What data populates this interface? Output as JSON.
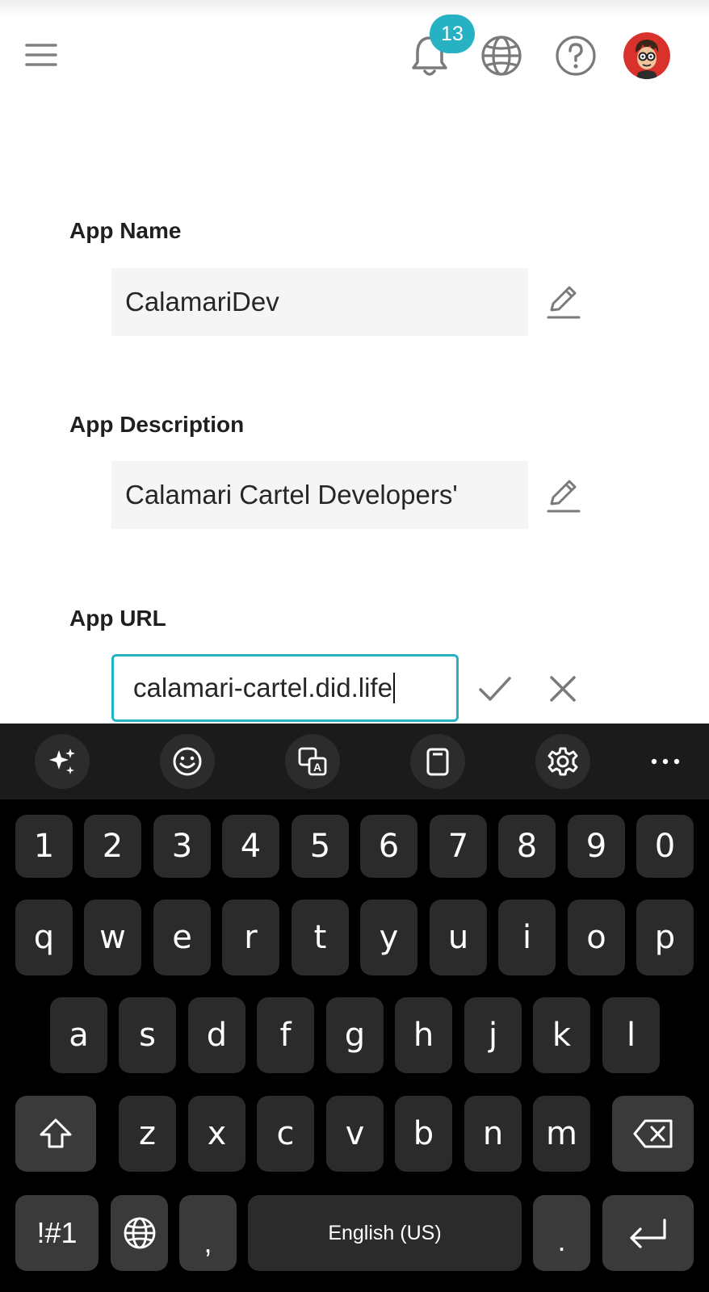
{
  "header": {
    "menu_icon": "hamburger-menu-icon",
    "notifications": {
      "icon": "bell-icon",
      "count": "13"
    },
    "language_icon": "globe-icon",
    "help_icon": "question-circle-icon",
    "avatar": "user-avatar"
  },
  "form": {
    "app_name": {
      "label": "App Name",
      "value": "CalamariDev"
    },
    "app_description": {
      "label": "App Description",
      "value": "Calamari Cartel Developers'"
    },
    "app_url": {
      "label": "App URL",
      "value": "calamari-cartel.did.life"
    }
  },
  "keyboard": {
    "toolbar": [
      "sparkle-ai-icon",
      "emoji-icon",
      "translate-icon",
      "clipboard-icon",
      "settings-gear-icon",
      "more-dots-icon"
    ],
    "row_numbers": [
      "1",
      "2",
      "3",
      "4",
      "5",
      "6",
      "7",
      "8",
      "9",
      "0"
    ],
    "row_top": [
      "q",
      "w",
      "e",
      "r",
      "t",
      "y",
      "u",
      "i",
      "o",
      "p"
    ],
    "row_middle": [
      "a",
      "s",
      "d",
      "f",
      "g",
      "h",
      "j",
      "k",
      "l"
    ],
    "row_bottom": [
      "z",
      "x",
      "c",
      "v",
      "b",
      "n",
      "m"
    ],
    "symbols_key": "!#1",
    "comma_key": ",",
    "space_label": "English (US)",
    "period_key": ".",
    "colors": {
      "background": "#000000",
      "key": "#2b2b2b",
      "modifier_key": "#3a3a3a",
      "toolbar": "#1b1b1b"
    }
  },
  "colors": {
    "accent": "#27b2c4",
    "field_background": "#f5f5f5",
    "icon": "#7a7a7a"
  }
}
